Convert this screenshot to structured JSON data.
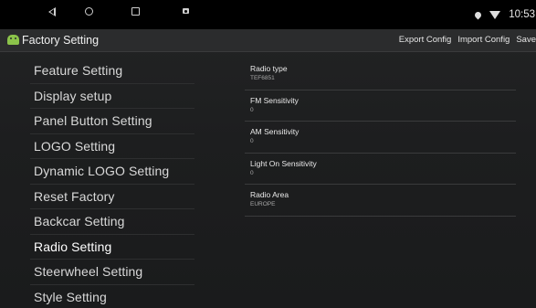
{
  "status_bar": {
    "time": "10:53",
    "icons": [
      "location-icon",
      "wifi-icon"
    ],
    "nav": [
      "back-icon",
      "home-icon",
      "recent-apps-icon",
      "screenshot-icon"
    ]
  },
  "header": {
    "title": "Factory Setting",
    "actions": {
      "export": "Export Config",
      "import": "Import Config",
      "save": "Save"
    }
  },
  "menu": {
    "items": [
      {
        "label": "Feature Setting"
      },
      {
        "label": "Display setup"
      },
      {
        "label": "Panel Button Setting"
      },
      {
        "label": "LOGO Setting"
      },
      {
        "label": "Dynamic LOGO Setting"
      },
      {
        "label": "Reset Factory"
      },
      {
        "label": "Backcar Setting"
      },
      {
        "label": "Radio Setting"
      },
      {
        "label": "Steerwheel Setting"
      },
      {
        "label": "Style Setting"
      }
    ],
    "selected": "Radio Setting"
  },
  "radio_settings": [
    {
      "name": "Radio type",
      "value": "TEF6851"
    },
    {
      "name": "FM Sensitivity",
      "value": "0"
    },
    {
      "name": "AM Sensitivity",
      "value": "0"
    },
    {
      "name": "Light On Sensitivity",
      "value": "0"
    },
    {
      "name": "Radio Area",
      "value": "EUROPE"
    }
  ],
  "colors": {
    "background": "#1b1c1d",
    "title_bar": "#2b2c2d",
    "app_icon": "#8bc34a",
    "text": "#e6e6e6"
  }
}
